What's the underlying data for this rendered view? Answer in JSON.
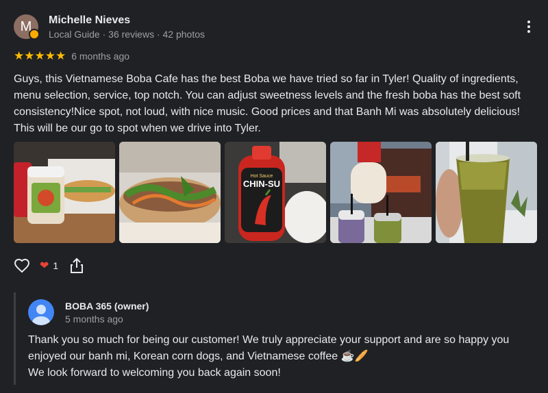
{
  "review": {
    "author": {
      "initial": "M",
      "name": "Michelle Nieves",
      "meta": "Local Guide · 36 reviews · 42 photos"
    },
    "rating_stars": "★★★★★",
    "rating": 5,
    "time_ago": "6 months ago",
    "text": "Guys, this Vietnamese Boba Cafe has the best Boba we have tried so far in Tyler! Quality of ingredients, menu selection, service, top notch. You can adjust sweetness levels and the fresh boba has the best soft consistency!Nice spot, not loud, with nice music. Good prices and that Banh Mi was absolutely delicious! This will be our go to spot when we drive into Tyler.",
    "photos": [
      {
        "icon": "banh-mi-and-sauce-jar-photo"
      },
      {
        "icon": "banh-mi-closeup-photo"
      },
      {
        "icon": "chin-su-hot-sauce-photo",
        "label": "CHIN-SU",
        "sublabel": "Hot Sauce"
      },
      {
        "icon": "two-boba-drinks-photo"
      },
      {
        "icon": "green-tea-drink-photo"
      }
    ],
    "reactions": {
      "heart_count": "1"
    }
  },
  "owner_reply": {
    "name": "BOBA 365 (owner)",
    "time_ago": "5 months ago",
    "line1": "Thank you so much for being our customer! We truly appreciate your support and are so happy you enjoyed our banh mi, Korean corn dogs, and Vietnamese coffee ☕🥖",
    "line2": "We look forward to welcoming you back again soon!"
  },
  "colors": {
    "background": "#202124",
    "star": "#fbbc04",
    "heart": "#ea4335",
    "owner_avatar": "#4285f4"
  }
}
